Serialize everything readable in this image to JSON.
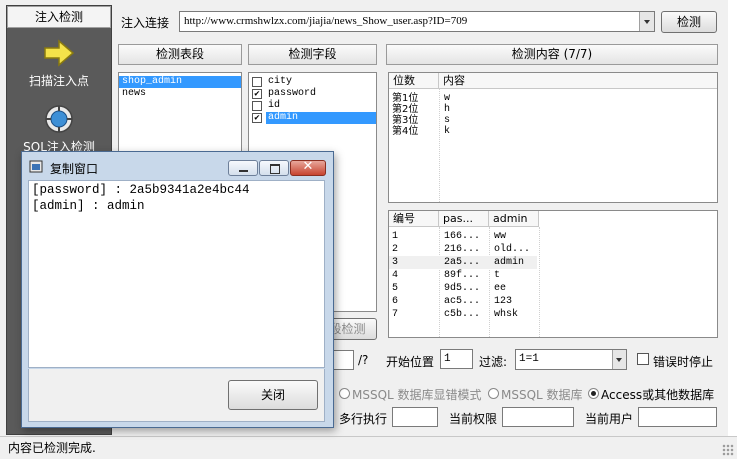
{
  "sidebar": {
    "tab": "注入检测",
    "tools": [
      {
        "label": "扫描注入点",
        "icon": "arrow-right-icon"
      },
      {
        "label": "SQL注入检测",
        "icon": "sql-globe-icon"
      }
    ]
  },
  "url_bar": {
    "label": "注入连接",
    "value": "http://www.crmshwlzx.com/jiajia/news_Show_user.asp?ID=709",
    "detect_button": "检测"
  },
  "tables_panel": {
    "header": "检测表段",
    "items": [
      {
        "name": "shop_admin",
        "selected": true
      },
      {
        "name": "news",
        "selected": false
      }
    ]
  },
  "fields_panel": {
    "header": "检测字段",
    "items": [
      {
        "name": "city",
        "checked": false,
        "selected": false
      },
      {
        "name": "password",
        "checked": true,
        "selected": false
      },
      {
        "name": "id",
        "checked": false,
        "selected": false
      },
      {
        "name": "admin",
        "checked": true,
        "selected": true
      }
    ],
    "button_partial": "段检测"
  },
  "content_panel": {
    "header": "检测内容 (7/7)",
    "columns": [
      "位数",
      "内容"
    ],
    "rows": [
      [
        "第1位",
        "w"
      ],
      [
        "第2位",
        "h"
      ],
      [
        "第3位",
        "s"
      ],
      [
        "第4位",
        "k"
      ]
    ]
  },
  "records_panel": {
    "columns": [
      "编号",
      "pas...",
      "admin"
    ],
    "rows": [
      [
        "1",
        "166...",
        "ww"
      ],
      [
        "2",
        "216...",
        "old..."
      ],
      [
        "3",
        "2a5...",
        "admin"
      ],
      [
        "4",
        "89f...",
        "t"
      ],
      [
        "5",
        "9d5...",
        "ee"
      ],
      [
        "6",
        "ac5...",
        "123"
      ],
      [
        "7",
        "c5b...",
        "whsk"
      ]
    ],
    "highlight_row": 2
  },
  "controls": {
    "slash_label": "/?",
    "start_label": "开始位置",
    "start_value": "1",
    "filter_label": "过滤:",
    "filter_value": "1=1",
    "error_stop_label": "错误时停止",
    "radio_mssql_error": "MSSQL 数据库显错模式",
    "radio_mssql": "MSSQL 数据库",
    "radio_access": "Access或其他数据库",
    "multi_exec_label": "多行执行",
    "current_perm_label": "当前权限",
    "current_user_label": "当前用户"
  },
  "status": {
    "text": "内容已检测完成."
  },
  "popup": {
    "title": "复制窗口",
    "lines": [
      "[password] : 2a5b9341a2e4bc44",
      "[admin] : admin"
    ],
    "close_button": "关闭"
  }
}
